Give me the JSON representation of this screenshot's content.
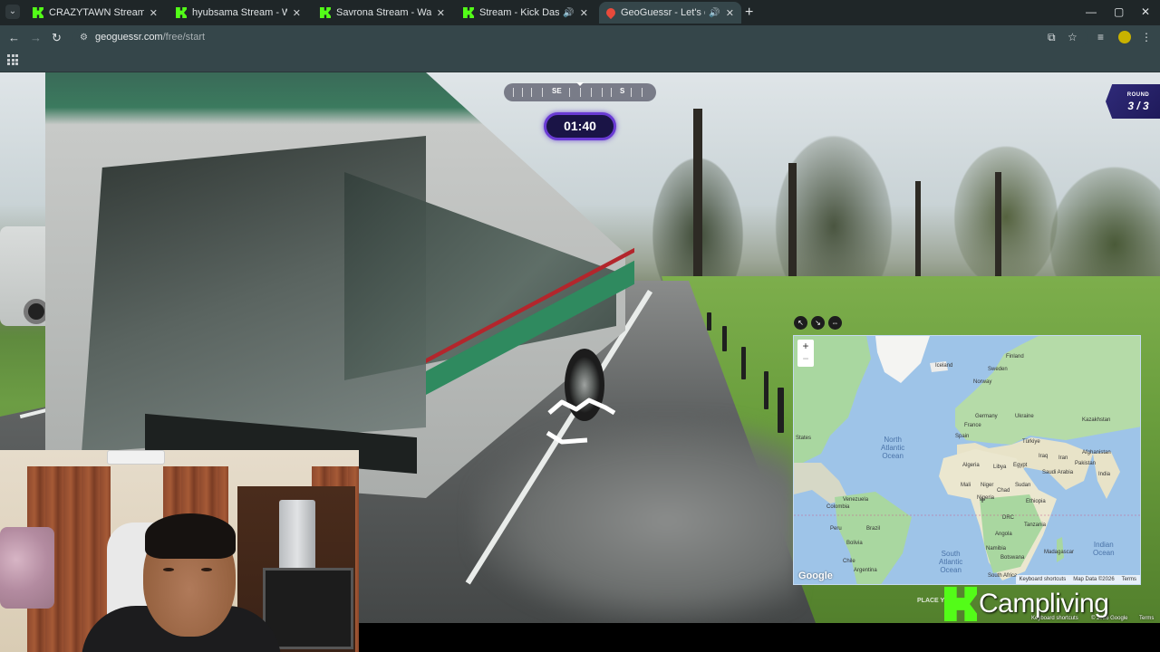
{
  "browser": {
    "tabs": [
      {
        "title": "CRAZYTAWN Stream - Watch Li",
        "favicon": "kick-icon",
        "active": false
      },
      {
        "title": "hyubsama Stream - Watch Live",
        "favicon": "kick-icon",
        "active": false
      },
      {
        "title": "Savrona Stream - Watch Live o",
        "favicon": "kick-icon",
        "active": false
      },
      {
        "title": "Stream - Kick Dashboard",
        "favicon": "kick-icon",
        "active": false,
        "audio": true
      },
      {
        "title": "GeoGuessr - Let's explore t",
        "favicon": "geoguessr-icon",
        "active": true,
        "audio": true
      }
    ],
    "url_host": "geoguessr.com",
    "url_path": "/free/start",
    "window_controls": {
      "minimize": "—",
      "maximize": "▢",
      "close": "✕"
    }
  },
  "game": {
    "compass": {
      "left": "SE",
      "right": "S"
    },
    "timer": "01:40",
    "round_label": "ROUND",
    "round_value": "3 / 3",
    "place_label": "PLACE Y"
  },
  "map": {
    "zoom_in": "+",
    "zoom_out": "−",
    "labels": {
      "iceland": "Iceland",
      "finland": "Finland",
      "sweden": "Sweden",
      "norway": "Norway",
      "ukraine": "Ukraine",
      "germany": "Germany",
      "france": "France",
      "kazakhstan": "Kazakhstan",
      "spain": "Spain",
      "turkiye": "Türkiye",
      "afghanistan": "Afghanistan",
      "iraq": "Iraq",
      "iran": "Iran",
      "algeria": "Algeria",
      "libya": "Libya",
      "egypt": "Egypt",
      "saudi_arabia": "Saudi Arabia",
      "pakistan": "Pakistan",
      "india": "India",
      "mali": "Mali",
      "niger": "Niger",
      "chad": "Chad",
      "sudan": "Sudan",
      "ethiopia": "Ethiopia",
      "nigeria": "Nigeria",
      "drc": "DRC",
      "tanzania": "Tanzania",
      "angola": "Angola",
      "namibia": "Namibia",
      "botswana": "Botswana",
      "madagascar": "Madagascar",
      "south_africa": "South Africa",
      "venezuela": "Venezuela",
      "colombia": "Colombia",
      "peru": "Peru",
      "brazil": "Brazil",
      "bolivia": "Bolivia",
      "chile": "Chile",
      "argentina": "Argentina",
      "states": "States"
    },
    "oceans": {
      "north_atlantic": "North\nAtlantic\nOcean",
      "south_atlantic": "South\nAtlantic\nOcean",
      "indian": "Indian\nOcean"
    },
    "google": "Google",
    "footer": [
      "Keyboard shortcuts",
      "Map Data ©2026",
      "Terms"
    ]
  },
  "footer_small": {
    "keyboard": "Keyboard shortcuts",
    "copyright": "© 2026 Google",
    "terms": "Terms"
  },
  "watermark": "Campliving",
  "colors": {
    "timer_ring": "#6a3bd4",
    "kick_green": "#53fc18",
    "round_bg": "#2f2a79"
  }
}
